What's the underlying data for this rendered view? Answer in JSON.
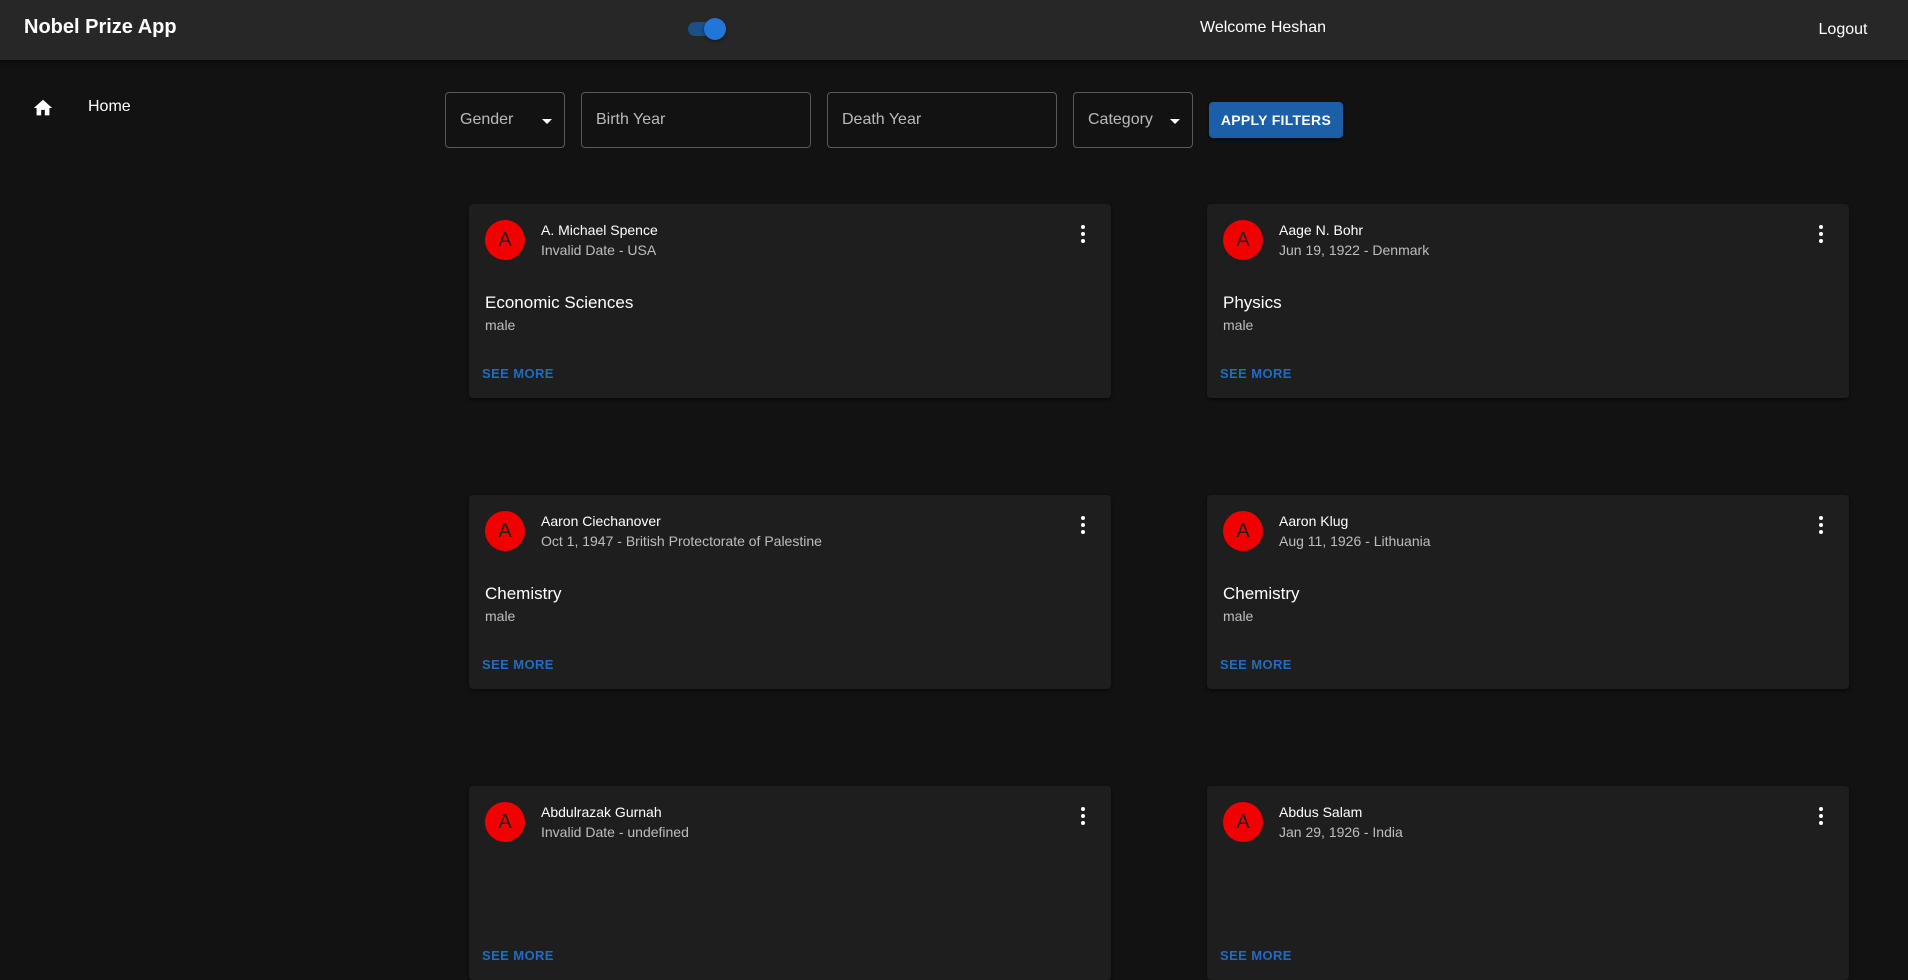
{
  "header": {
    "title": "Nobel Prize App",
    "theme_icon": "moon-icon",
    "dark_mode_on": true,
    "welcome": "Welcome Heshan",
    "logout_label": "Logout"
  },
  "sidebar": {
    "items": [
      {
        "icon": "home-icon",
        "label": "Home"
      }
    ]
  },
  "filters": {
    "gender_label": "Gender",
    "birth_year_placeholder": "Birth Year",
    "death_year_placeholder": "Death Year",
    "category_label": "Category",
    "apply_label": "APPLY FILTERS"
  },
  "colors": {
    "avatar": "#f00000",
    "accent": "#1a5fa8",
    "background": "#121212",
    "card": "#1e1e1e"
  },
  "cards": [
    {
      "initial": "A",
      "name": "A. Michael Spence",
      "subtitle": "Invalid Date - USA",
      "category": "Economic Sciences",
      "gender": "male",
      "action": "SEE MORE"
    },
    {
      "initial": "A",
      "name": "Aage N. Bohr",
      "subtitle": "Jun 19, 1922 - Denmark",
      "category": "Physics",
      "gender": "male",
      "action": "SEE MORE"
    },
    {
      "initial": "A",
      "name": "Aaron Ciechanover",
      "subtitle": "Oct 1, 1947 - British Protectorate of Palestine",
      "category": "Chemistry",
      "gender": "male",
      "action": "SEE MORE"
    },
    {
      "initial": "A",
      "name": "Aaron Klug",
      "subtitle": "Aug 11, 1926 - Lithuania",
      "category": "Chemistry",
      "gender": "male",
      "action": "SEE MORE"
    },
    {
      "initial": "A",
      "name": "Abdulrazak Gurnah",
      "subtitle": "Invalid Date - undefined",
      "category": "",
      "gender": "",
      "action": "SEE MORE"
    },
    {
      "initial": "A",
      "name": "Abdus Salam",
      "subtitle": "Jan 29, 1926 - India",
      "category": "",
      "gender": "",
      "action": "SEE MORE"
    }
  ]
}
